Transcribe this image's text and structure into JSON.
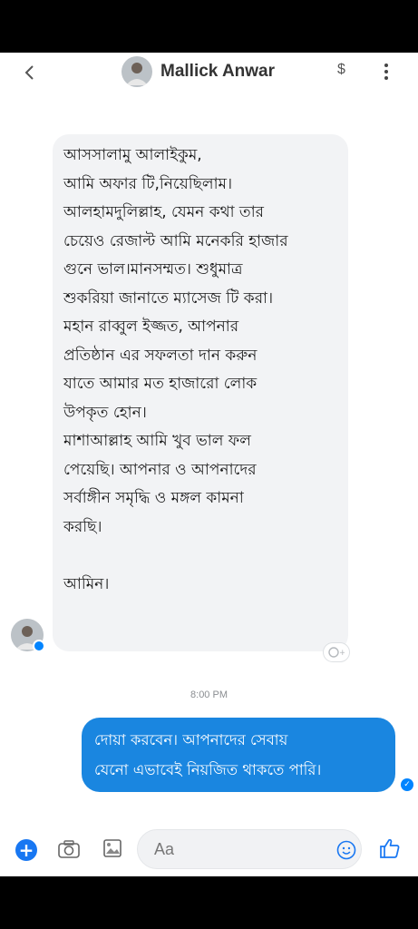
{
  "header": {
    "back_icon": "chevron-left-icon",
    "contact_name": "Mallick Anwar",
    "payment_symbol": "$",
    "more_icon": "more-vertical-icon"
  },
  "incoming_message": {
    "text": "আসসালামু আলাইকুম,\nআমি অফার টি,নিয়েছিলাম।\nআলহামদুলিল্লাহ, যেমন কথা তার\nচেয়েও রেজাল্ট আমি মনেকরি হাজার\nগুনে ভাল।মানসম্মত। শুধুমাত্র\nশুকরিয়া জানাতে ম্যাসেজ টি করা।\nমহান রাব্বুল ইজ্জত, আপনার\nপ্রতিষ্ঠান এর সফলতা দান করুন\nযাতে আমার মত হাজারো লোক\nউপকৃত হোন।\nমাশাআল্লাহ আমি খুব ভাল ফল\nপেয়েছি। আপনার ও আপনাদের\nসর্বাঙ্গীন সমৃদ্ধি ও মঙ্গল কামনা\nকরছি।\n\nআমিন।"
  },
  "timestamp": "8:00 PM",
  "outgoing_message": {
    "text": "দোয়া করবেন। আপনাদের সেবায়\nযেনো এভাবেই নিয়জিত থাকতে পারি।"
  },
  "composer": {
    "placeholder": "Aa"
  },
  "colors": {
    "accent": "#1877f2",
    "outgoing_bubble": "#1a86e0",
    "incoming_bubble": "#f2f3f5"
  }
}
